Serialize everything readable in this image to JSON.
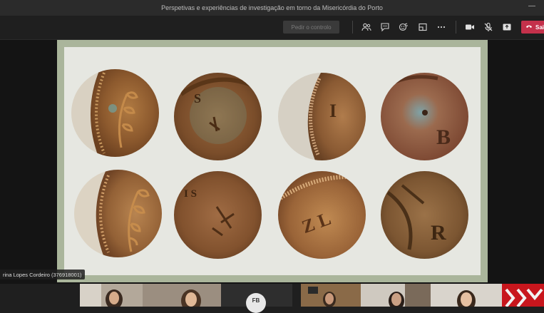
{
  "window": {
    "title": "Perspetivas e experiências de investigação em torno da Misericórdia do Porto",
    "minimize_glyph": "—"
  },
  "toolbar": {
    "pedir_label": "Pedir o controlo",
    "sair_label": "Sair",
    "icons": [
      "participants-icon",
      "chat-icon",
      "reactions-icon",
      "rooms-icon",
      "more-icon",
      "camera-icon",
      "mic-off-icon",
      "share-icon",
      "phone-icon"
    ]
  },
  "presenter": {
    "name_label": "rina Lopes Cordeiro (376918001)"
  },
  "gallery": {
    "avatar_initials": "FB",
    "tiles": [
      "participant-1",
      "participant-2",
      "participant-3",
      "participant-4",
      "participant-5",
      "participant-6",
      "participant-7"
    ]
  },
  "slide": {
    "coin_letters": {
      "c2": "S",
      "c3": "I",
      "c4": "B",
      "c6": "I S",
      "c7": "Z L",
      "c8": "R"
    }
  },
  "colors": {
    "titlebar": "#2b2b2b",
    "leave_button": "#c4314b",
    "slide_border": "#aab59b",
    "slide_bg": "#e6e7e1"
  }
}
